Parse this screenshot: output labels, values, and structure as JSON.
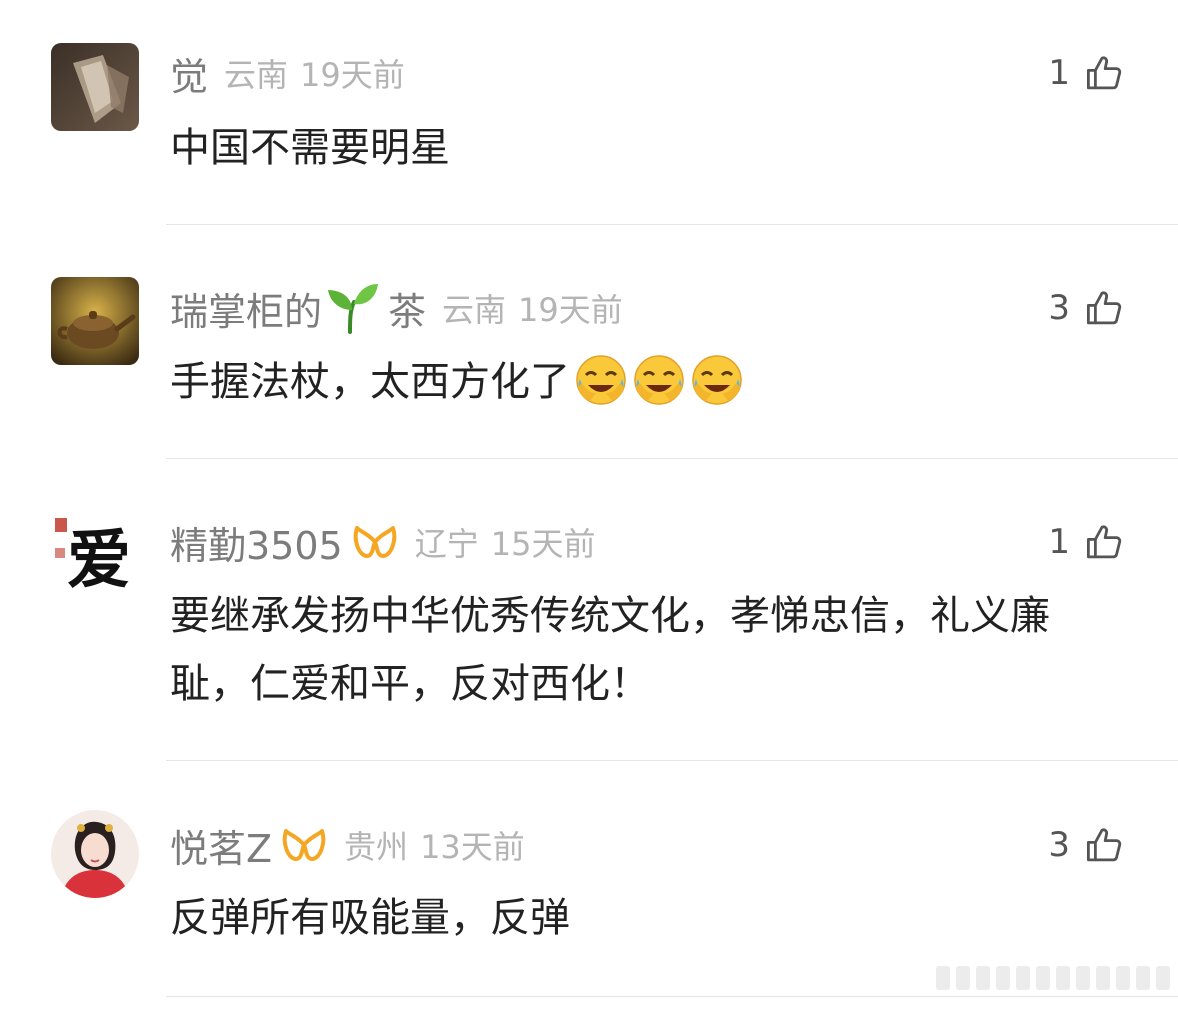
{
  "comments": [
    {
      "username": "觉",
      "location": "云南",
      "time": "19天前",
      "likes": "1",
      "text": "中国不需要明星",
      "avatar_icon": "hand-book-avatar",
      "badge": null
    },
    {
      "username": "瑞掌柜的",
      "username_suffix": "茶",
      "inline_emoji": "seedling-emoji",
      "location": "云南",
      "time": "19天前",
      "likes": "3",
      "text": "手握法杖，太西方化了",
      "text_emojis": [
        "laughing-crying-emoji",
        "laughing-crying-emoji",
        "laughing-crying-emoji"
      ],
      "avatar_icon": "teapot-avatar",
      "badge": null
    },
    {
      "username": "精勤3505",
      "location": "辽宁",
      "time": "15天前",
      "likes": "1",
      "text": "要继承发扬中华优秀传统文化，孝悌忠信，礼义廉耻，仁爱和平，反对西化！",
      "avatar_icon": "calligraphy-avatar",
      "avatar_char": "爱",
      "badge": "vip-icon"
    },
    {
      "username": "悦茗Z",
      "location": "贵州",
      "time": "13天前",
      "likes": "3",
      "text": "反弹所有吸能量，反弹",
      "avatar_icon": "costume-girl-avatar",
      "badge": "vip-icon"
    }
  ],
  "colors": {
    "username": "#7c7c7c",
    "meta": "#b4b4b4",
    "text": "#222222",
    "divider": "#e6e6e6",
    "vip_badge": "#f5a623"
  }
}
